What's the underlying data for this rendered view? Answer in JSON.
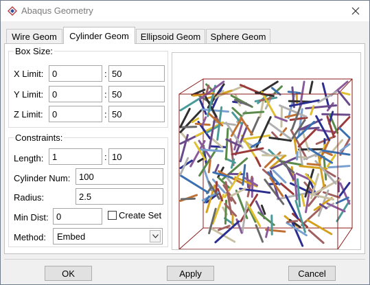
{
  "window": {
    "title": "Abaqus Geometry"
  },
  "tabs": [
    {
      "label": "Wire Geom"
    },
    {
      "label": "Cylinder Geom"
    },
    {
      "label": "Ellipsoid Geom"
    },
    {
      "label": "Sphere Geom"
    }
  ],
  "active_tab": "Cylinder Geom",
  "box_size": {
    "title": "Box Size:",
    "separator": ":",
    "x": {
      "label": "X Limit:",
      "min": "0",
      "max": "50"
    },
    "y": {
      "label": "Y Limit:",
      "min": "0",
      "max": "50"
    },
    "z": {
      "label": "Z Limit:",
      "min": "0",
      "max": "50"
    }
  },
  "constraints": {
    "title": "Constraints:",
    "length": {
      "label": "Length:",
      "min": "1",
      "max": "10"
    },
    "cylinder_num": {
      "label": "Cylinder Num:",
      "value": "100"
    },
    "radius": {
      "label": "Radius:",
      "value": "2.5"
    },
    "min_dist": {
      "label": "Min Dist:",
      "value": "0"
    },
    "create_set": {
      "label": "Create Set",
      "checked": false
    },
    "method": {
      "label": "Method:",
      "value": "Embed"
    }
  },
  "buttons": {
    "ok": "OK",
    "apply": "Apply",
    "cancel": "Cancel"
  },
  "colors": {
    "box_edge": "#8b1a1a",
    "accent": "#1b5fb6"
  }
}
